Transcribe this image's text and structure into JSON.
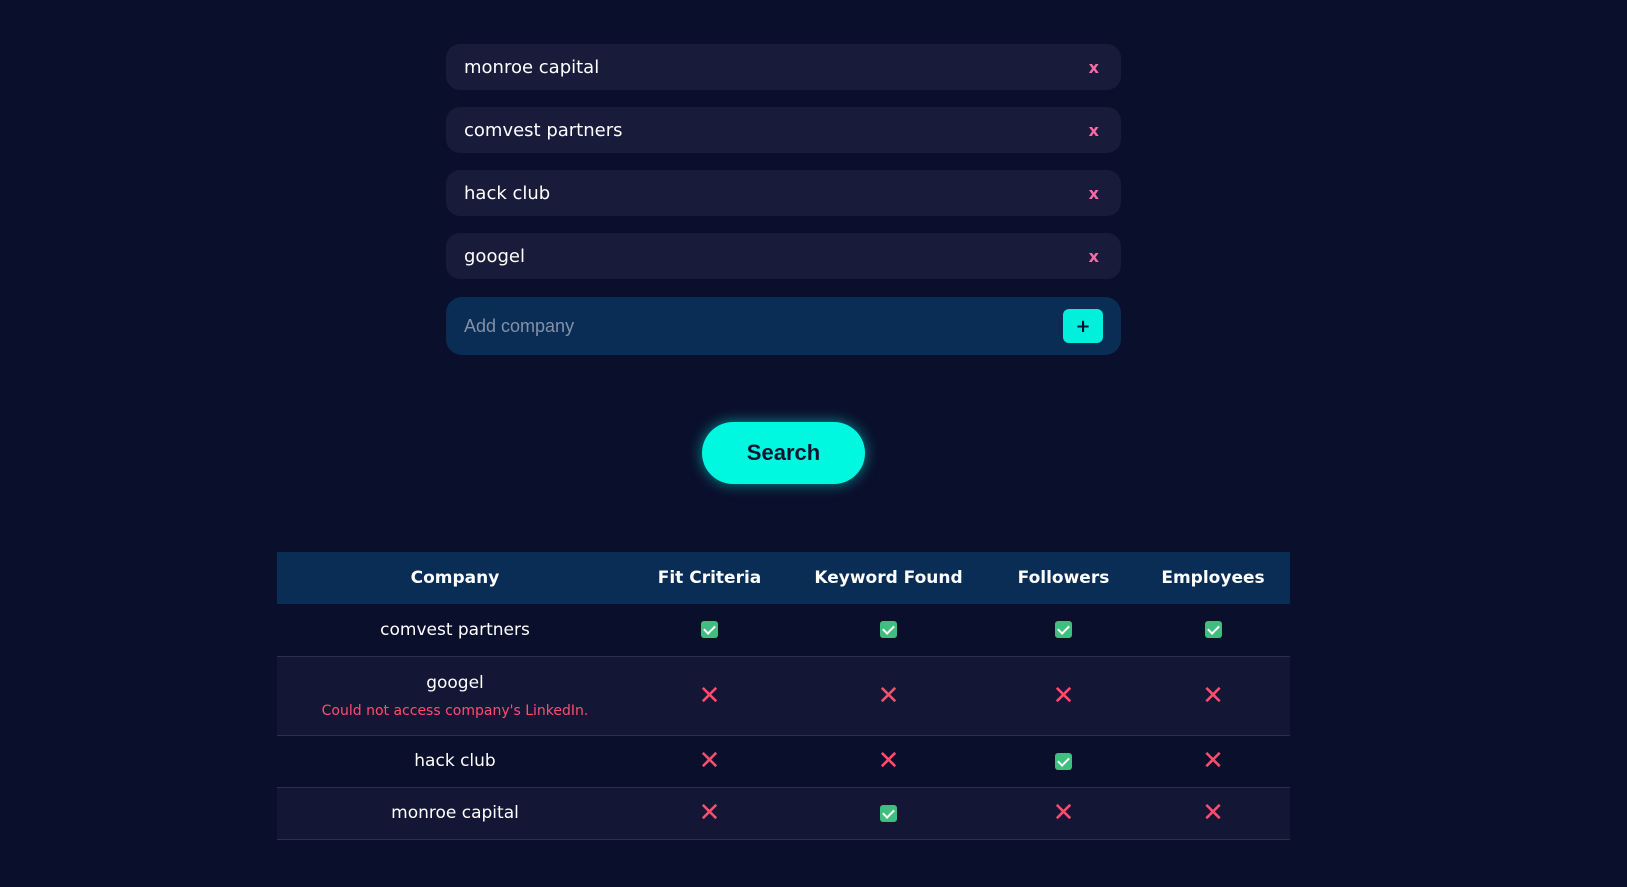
{
  "companies": [
    {
      "name": "monroe capital",
      "remove_label": "x"
    },
    {
      "name": "comvest partners",
      "remove_label": "x"
    },
    {
      "name": "hack club",
      "remove_label": "x"
    },
    {
      "name": "googel",
      "remove_label": "x"
    }
  ],
  "add_company": {
    "placeholder": "Add company",
    "button_label": "+"
  },
  "search": {
    "label": "Search"
  },
  "table": {
    "headers": [
      "Company",
      "Fit Criteria",
      "Keyword Found",
      "Followers",
      "Employees"
    ],
    "rows": [
      {
        "company": "comvest partners",
        "error": "",
        "fit": true,
        "keyword": true,
        "followers": true,
        "employees": true
      },
      {
        "company": "googel",
        "error": "Could not access company's LinkedIn.",
        "fit": false,
        "keyword": false,
        "followers": false,
        "employees": false
      },
      {
        "company": "hack club",
        "error": "",
        "fit": false,
        "keyword": false,
        "followers": true,
        "employees": false
      },
      {
        "company": "monroe capital",
        "error": "",
        "fit": false,
        "keyword": true,
        "followers": false,
        "employees": false
      }
    ]
  },
  "icons": {
    "check": "check-icon",
    "cross": "cross-icon"
  },
  "colors": {
    "background": "#0a0f2c",
    "accent": "#00f7e0",
    "chip": "#181c3a",
    "header": "#0a2d55",
    "error": "#ff4d6d",
    "success": "#3fbf7f",
    "remove": "#ff6aa6"
  }
}
